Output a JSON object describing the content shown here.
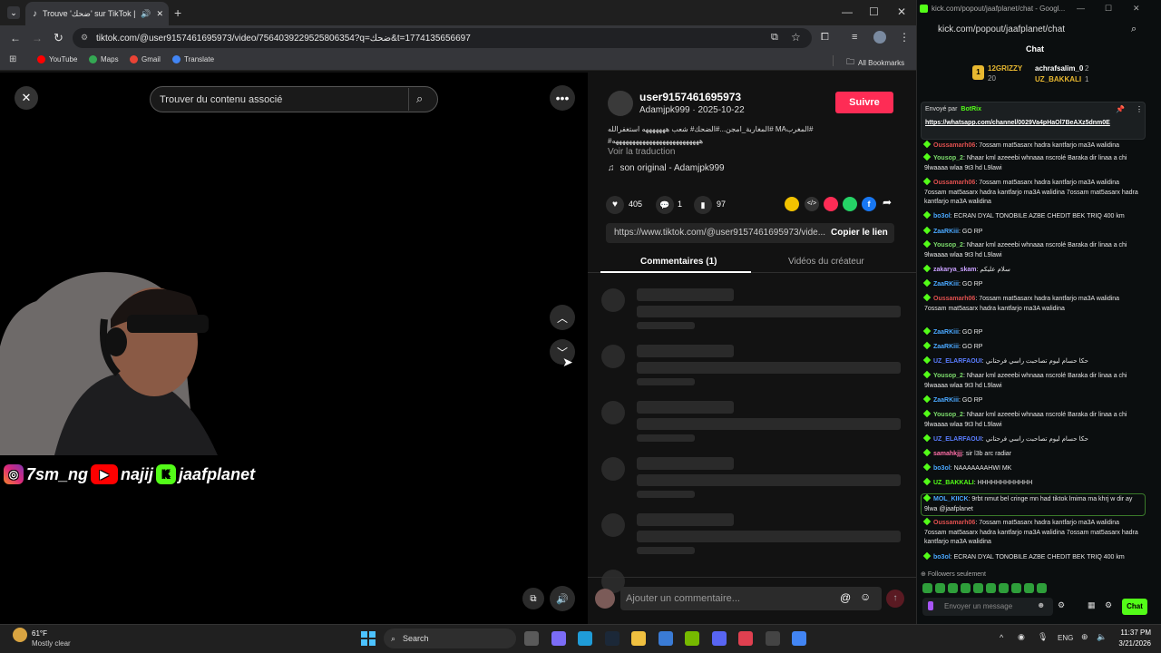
{
  "chrome": {
    "tab_title": "Trouve 'ضحك' sur TikTok | R",
    "url": "tiktok.com/@user9157461695973/video/7564039229525806354?q=ضحك&t=1774135656697",
    "bookmarks": [
      "YouTube",
      "Maps",
      "Gmail",
      "Translate"
    ],
    "all_bookmarks": "All Bookmarks"
  },
  "tiktok": {
    "search_placeholder": "Trouver du contenu associé",
    "username": "user9157461695973",
    "meta": "Adamjpk999 · 2025-10-22",
    "follow": "Suivre",
    "desc1": "#المغربMA #المغاربة_امجن...#الضحك# شعب هههههههه استغفرالله",
    "desc2": "#ههههههههههههههههههههههههههه",
    "translate": "Voir la traduction",
    "sound": "son original - Adamjpk999",
    "likes": "405",
    "comments": "1",
    "saves": "97",
    "link": "https://www.tiktok.com/@user9157461695973/vide...",
    "copy_link": "Copier le lien",
    "tab_comments": "Commentaires (1)",
    "tab_videos": "Vidéos du créateur",
    "add_comment": "Ajouter un commentaire..."
  },
  "overlay": {
    "instagram": "7sm_ng",
    "youtube": "najij",
    "kick": "jaafplanet"
  },
  "kick": {
    "window_title": "kick.com/popout/jaafplanet/chat - Googl...",
    "url": "kick.com/popout/jaafplanet/chat",
    "chat_header": "Chat",
    "top1": "12GRIZZY",
    "top1_count": "20",
    "top2": "achrafsalim_0",
    "top2_count": "2",
    "top3": "UZ_BAKKALI",
    "top3_count": "1",
    "pinned_by": "Envoyé par",
    "pinned_user": "BotRix",
    "pinned_link": "https://whatsapp.com/channel/0029Va4pHaOl7BeAXz5dnm0E",
    "messages": [
      {
        "user": "Oussamarh06",
        "color": "#e0504f",
        "text": "7ossam mat5asarx hadra kantfarjo ma3A walidina"
      },
      {
        "user": "Yousop_2",
        "color": "#7cdc6c",
        "text": "Nhaar kml azeeebi whnaaa nscrolé Baraka dir linaa a chi 9lwaaaa wlaa 9t3 hd L9lawi"
      },
      {
        "user": "Oussamarh06",
        "color": "#e0504f",
        "text": "7ossam mat5asarx hadra kantfarjo ma3A walidina 7ossam mat5asarx hadra kantfarjo ma3A walidina 7ossam mat5asarx hadra kantfarjo ma3A walidina"
      },
      {
        "user": "bo3ol",
        "color": "#4aa8ff",
        "text": "ECRAN DYAL TONOBILE AZBE CHEDIT BEK TRIQ 400 km"
      },
      {
        "user": "ZaaRKiii",
        "color": "#4aa8ff",
        "text": "GO RP"
      },
      {
        "user": "Yousop_2",
        "color": "#7cdc6c",
        "text": "Nhaar kml azeeebi whnaaa nscrolé Baraka dir linaa a chi 9lwaaaa wlaa 9t3 hd L9lawi"
      },
      {
        "user": "zakarya_skam",
        "color": "#c9a0ff",
        "text": "سلام عليكم"
      },
      {
        "user": "ZaaRKiii",
        "color": "#4aa8ff",
        "text": "GO RP"
      },
      {
        "user": "Oussamarh06",
        "color": "#e0504f",
        "text": "7ossam mat5asarx hadra kantfarjo ma3A walidina 7ossam mat5asarx hadra kantfarjo ma3A walidina"
      },
      {
        "user": "ZaaRKiii",
        "color": "#4aa8ff",
        "text": "GO RP"
      },
      {
        "user": "ZaaRKiii",
        "color": "#4aa8ff",
        "text": "GO RP"
      },
      {
        "user": "UZ_ELARFAOUI",
        "color": "#5a7dff",
        "text": "حكا حسام ليوم تصاحبت راسي فرحتاني"
      },
      {
        "user": "Yousop_2",
        "color": "#7cdc6c",
        "text": "Nhaar kml azeeebi whnaaa nscrolé Baraka dir linaa a chi 9lwaaaa wlaa 9t3 hd L9lawi"
      },
      {
        "user": "ZaaRKiii",
        "color": "#4aa8ff",
        "text": "GO RP"
      },
      {
        "user": "Yousop_2",
        "color": "#7cdc6c",
        "text": "Nhaar kml azeeebi whnaaa nscrolé Baraka dir linaa a chi 9lwaaaa wlaa 9t3 hd L9lawi"
      },
      {
        "user": "UZ_ELARFAOUI",
        "color": "#5a7dff",
        "text": "حكا حسام ليوم تصاحبت راسي فرحتاني"
      },
      {
        "user": "samahkjjj",
        "color": "#ff6fa8",
        "text": "sir l3b arc radiar"
      },
      {
        "user": "bo3ol",
        "color": "#4aa8ff",
        "text": "NAAAAAAAHWI MK"
      },
      {
        "user": "UZ_BAKKALI",
        "color": "#53fc18",
        "text": "HHHHHHHHHHHH"
      },
      {
        "user": "MOL_KIICK",
        "color": "#4aa8ff",
        "text": "9rbt nmut bel cringe mn had tiktok lmima ma khrj w dir ay 9lwa @jaafplanet"
      },
      {
        "user": "Oussamarh06",
        "color": "#e0504f",
        "text": "7ossam mat5asarx hadra kantfarjo ma3A walidina 7ossam mat5asarx hadra kantfarjo ma3A walidina 7ossam mat5asarx hadra kantfarjo ma3A walidina"
      },
      {
        "user": "bo3ol",
        "color": "#4aa8ff",
        "text": "ECRAN DYAL TONOBILE AZBE CHEDIT BEK TRIQ 400 km"
      }
    ],
    "followers_only": "Followers seulement",
    "send_placeholder": "Envoyer un message",
    "chat_button": "Chat"
  },
  "taskbar": {
    "temp": "61°F",
    "weather": "Mostly clear",
    "search": "Search",
    "lang": "ENG",
    "time": "11:37 PM",
    "date": "3/21/2026"
  }
}
